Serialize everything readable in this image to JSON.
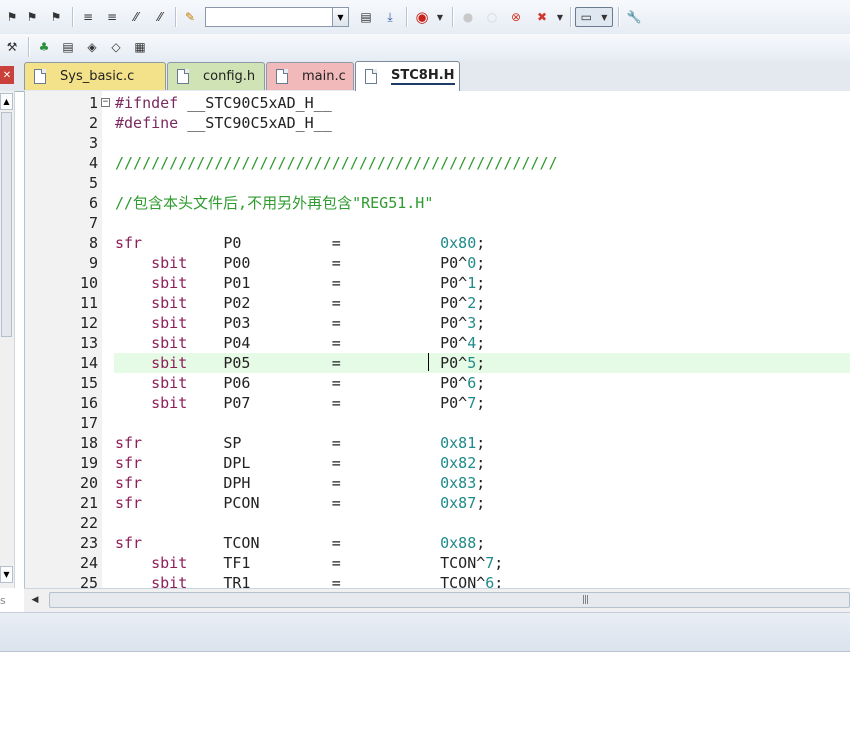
{
  "toolbar": {
    "find_placeholder": "",
    "icons": [
      "bookmark-toggle",
      "bookmark-prev",
      "bookmark-next",
      "bookmark-clear",
      "indent",
      "unindent",
      "comment",
      "uncomment",
      "open-find-icon",
      "find-in-files",
      "incremental-find",
      "debug",
      "breakpoint-insert",
      "breakpoint-enable",
      "breakpoint-disable",
      "breakpoint-kill",
      "window-select",
      "configure"
    ]
  },
  "tabs": [
    {
      "label": "Sys_basic.c",
      "color": "#f4e28a"
    },
    {
      "label": "config.h",
      "color": "#cfe3b4"
    },
    {
      "label": "main.c",
      "color": "#f1b9b9"
    },
    {
      "label": "STC8H.H",
      "color": "#ffffff",
      "active": true
    }
  ],
  "editor": {
    "highlighted_line": 14,
    "lines": [
      {
        "n": "1",
        "fold": "−",
        "segs": [
          [
            "kw-pre",
            "#ifndef"
          ],
          [
            "txt",
            " __STC90C5xAD_H__"
          ]
        ]
      },
      {
        "n": "2",
        "segs": [
          [
            "kw-pre",
            "#define"
          ],
          [
            "txt",
            " __STC90C5xAD_H__"
          ]
        ]
      },
      {
        "n": "3",
        "segs": []
      },
      {
        "n": "4",
        "segs": [
          [
            "cm",
            "/////////////////////////////////////////////////"
          ]
        ]
      },
      {
        "n": "5",
        "segs": []
      },
      {
        "n": "6",
        "segs": [
          [
            "cm",
            "//包含本头文件后,不用另外再包含\"REG51.H\""
          ]
        ]
      },
      {
        "n": "7",
        "segs": []
      },
      {
        "n": "8",
        "segs": [
          [
            "kw",
            "sfr"
          ],
          [
            "txt",
            "         P0          =           "
          ],
          [
            "num",
            "0x80"
          ],
          [
            "txt",
            ";"
          ]
        ]
      },
      {
        "n": "9",
        "segs": [
          [
            "kw",
            "    sbit"
          ],
          [
            "txt",
            "    P00         =           P0^"
          ],
          [
            "num",
            "0"
          ],
          [
            "txt",
            ";"
          ]
        ]
      },
      {
        "n": "10",
        "segs": [
          [
            "kw",
            "    sbit"
          ],
          [
            "txt",
            "    P01         =           P0^"
          ],
          [
            "num",
            "1"
          ],
          [
            "txt",
            ";"
          ]
        ]
      },
      {
        "n": "11",
        "segs": [
          [
            "kw",
            "    sbit"
          ],
          [
            "txt",
            "    P02         =           P0^"
          ],
          [
            "num",
            "2"
          ],
          [
            "txt",
            ";"
          ]
        ]
      },
      {
        "n": "12",
        "segs": [
          [
            "kw",
            "    sbit"
          ],
          [
            "txt",
            "    P03         =           P0^"
          ],
          [
            "num",
            "3"
          ],
          [
            "txt",
            ";"
          ]
        ]
      },
      {
        "n": "13",
        "segs": [
          [
            "kw",
            "    sbit"
          ],
          [
            "txt",
            "    P04         =           P0^"
          ],
          [
            "num",
            "4"
          ],
          [
            "txt",
            ";"
          ]
        ]
      },
      {
        "n": "14",
        "segs": [
          [
            "kw",
            "    sbit"
          ],
          [
            "txt",
            "    P05         =           P0^"
          ],
          [
            "num",
            "5"
          ],
          [
            "txt",
            ";"
          ]
        ]
      },
      {
        "n": "15",
        "segs": [
          [
            "kw",
            "    sbit"
          ],
          [
            "txt",
            "    P06         =           P0^"
          ],
          [
            "num",
            "6"
          ],
          [
            "txt",
            ";"
          ]
        ]
      },
      {
        "n": "16",
        "segs": [
          [
            "kw",
            "    sbit"
          ],
          [
            "txt",
            "    P07         =           P0^"
          ],
          [
            "num",
            "7"
          ],
          [
            "txt",
            ";"
          ]
        ]
      },
      {
        "n": "17",
        "segs": []
      },
      {
        "n": "18",
        "segs": [
          [
            "kw",
            "sfr"
          ],
          [
            "txt",
            "         SP          =           "
          ],
          [
            "num",
            "0x81"
          ],
          [
            "txt",
            ";"
          ]
        ]
      },
      {
        "n": "19",
        "segs": [
          [
            "kw",
            "sfr"
          ],
          [
            "txt",
            "         DPL         =           "
          ],
          [
            "num",
            "0x82"
          ],
          [
            "txt",
            ";"
          ]
        ]
      },
      {
        "n": "20",
        "segs": [
          [
            "kw",
            "sfr"
          ],
          [
            "txt",
            "         DPH         =           "
          ],
          [
            "num",
            "0x83"
          ],
          [
            "txt",
            ";"
          ]
        ]
      },
      {
        "n": "21",
        "segs": [
          [
            "kw",
            "sfr"
          ],
          [
            "txt",
            "         PCON        =           "
          ],
          [
            "num",
            "0x87"
          ],
          [
            "txt",
            ";"
          ]
        ]
      },
      {
        "n": "22",
        "segs": []
      },
      {
        "n": "23",
        "segs": [
          [
            "kw",
            "sfr"
          ],
          [
            "txt",
            "         TCON        =           "
          ],
          [
            "num",
            "0x88"
          ],
          [
            "txt",
            ";"
          ]
        ]
      },
      {
        "n": "24",
        "segs": [
          [
            "kw",
            "    sbit"
          ],
          [
            "txt",
            "    TF1         =           TCON^"
          ],
          [
            "num",
            "7"
          ],
          [
            "txt",
            ";"
          ]
        ]
      },
      {
        "n": "25",
        "segs": [
          [
            "kw",
            "    sbit"
          ],
          [
            "txt",
            "    TR1         =           TCON^"
          ],
          [
            "num",
            "6"
          ],
          [
            "txt",
            ";"
          ]
        ]
      }
    ]
  },
  "left_panel": {
    "bottom_label": "s"
  }
}
